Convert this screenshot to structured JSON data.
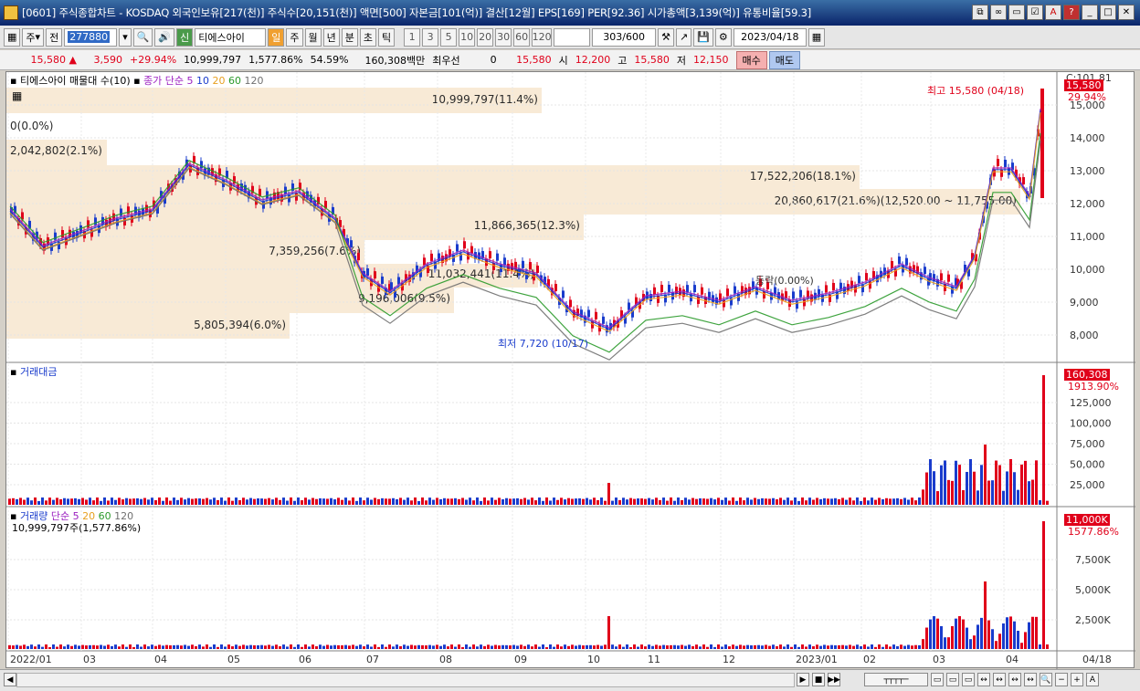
{
  "window": {
    "title": "[0601] 주식종합차트 - KOSDAQ 외국인보유[217(천)] 주식수[20,151(천)] 액면[500] 자본금[101(억)] 결산[12월] EPS[169] PER[92.36] 시가총액[3,139(억)] 유통비율[59.3]",
    "buttons": [
      "restore-icon",
      "link-icon",
      "window-icon",
      "checkbox-icon",
      "font-icon",
      "help-icon",
      "minimize-icon",
      "maximize-icon",
      "close-icon"
    ]
  },
  "toolbar": {
    "market": "주",
    "all_label": "전",
    "stock_code": "277880",
    "stock_name": "티에스아이",
    "new_label": "신",
    "period_selected": "일",
    "periods": [
      "주",
      "월",
      "년",
      "분",
      "초",
      "틱"
    ],
    "intervals": [
      "1",
      "3",
      "5",
      "10",
      "20",
      "30",
      "60",
      "120"
    ],
    "count": "303",
    "count_total": "/600",
    "date": "2023/04/18"
  },
  "quote": {
    "price": "15,580",
    "change": "3,590",
    "change_pct": "+29.94%",
    "volume": "10,999,797",
    "volume_pct": "1,577.86%",
    "turnover_pct": "54.59%",
    "trade_value": "160,308백만",
    "best_bid_label": "최우선",
    "best_bid": "0",
    "current": "15,580",
    "open_label": "시",
    "open": "12,200",
    "high_label": "고",
    "high": "15,580",
    "low_label": "저",
    "low": "12,150",
    "buy_label": "매수",
    "sell_label": "매도"
  },
  "price_panel": {
    "title": "티에스아이 매물대 수(10)",
    "ma_label": "종가 단순 5",
    "ma_periods": [
      "10",
      "20",
      "60",
      "120"
    ],
    "ma_colors": [
      "#9b1fc0",
      "#1a3ccc",
      "#e8a020",
      "#2a9a2a",
      "#707070"
    ],
    "top_label": "C:101.81",
    "current_box": "15,580",
    "current_pct": "29.94%",
    "y_ticks": [
      "15,000",
      "14,000",
      "13,000",
      "12,000",
      "11,000",
      "10,000",
      "9,000",
      "8,000"
    ],
    "volume_profile": [
      {
        "label": "10,999,797(11.4%)"
      },
      {
        "label": "0(0.0%)"
      },
      {
        "label": "2,042,802(2.1%)"
      },
      {
        "label": "17,522,206(18.1%)"
      },
      {
        "label": "20,860,617(21.6%)(12,520.00 ~ 11,755.00)"
      },
      {
        "label": "11,866,365(12.3%)"
      },
      {
        "label": "7,359,256(7.6%)"
      },
      {
        "label": "11,032,441(11.4%)"
      },
      {
        "label": "9,196,006(9.5%)"
      },
      {
        "label": "5,805,394(6.0%)"
      }
    ],
    "high_note": "최고 15,580 (04/18)",
    "low_note": "최저 7,720 (10/17)",
    "flat_note": "등락(0.00%)"
  },
  "trade_value_panel": {
    "title": "거래대금",
    "current_box": "160,308",
    "current_pct": "1913.90%",
    "y_ticks": [
      "125,000",
      "100,000",
      "75,000",
      "50,000",
      "25,000"
    ]
  },
  "volume_panel": {
    "title": "거래량",
    "ma_label": "단순 5",
    "ma_periods": [
      "20",
      "60",
      "120"
    ],
    "value_note": "10,999,797주(1,577.86%)",
    "current_box": "11,000K",
    "current_pct": "1577.86%",
    "y_ticks": [
      "7,500K",
      "5,000K",
      "2,500K"
    ]
  },
  "x_axis": {
    "ticks": [
      "2022/01",
      "03",
      "04",
      "05",
      "06",
      "07",
      "08",
      "09",
      "10",
      "11",
      "12",
      "2023/01",
      "02",
      "03",
      "04"
    ],
    "end_label": "04/18"
  },
  "colors": {
    "up": "#e0001a",
    "down": "#1a3ccc",
    "band": "#f8ead6"
  }
}
